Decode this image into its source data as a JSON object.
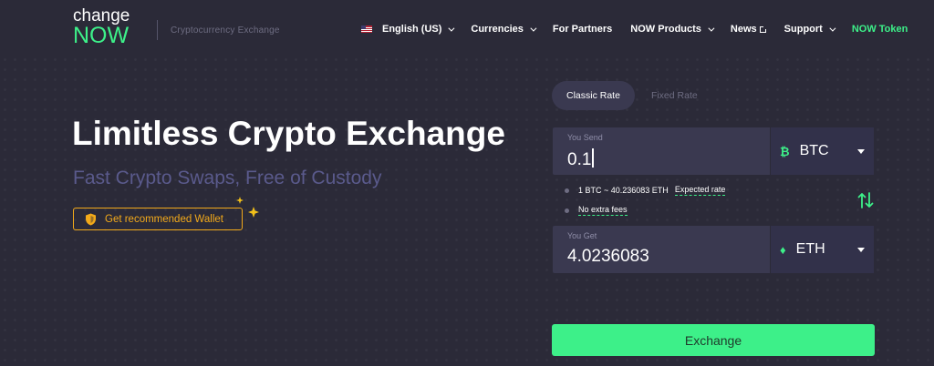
{
  "header": {
    "logo_top": "change",
    "logo_bottom": "NOW",
    "tagline": "Cryptocurrency Exchange",
    "nav": {
      "language": "English (US)",
      "currencies": "Currencies",
      "partners": "For Partners",
      "products": "NOW Products",
      "news": "News",
      "support": "Support",
      "token": "NOW Token"
    }
  },
  "hero": {
    "title": "Limitless Crypto Exchange",
    "subtitle": "Fast Crypto Swaps, Free of Custody",
    "wallet_button": "Get recommended Wallet"
  },
  "exchange": {
    "tabs": {
      "classic": "Classic Rate",
      "fixed": "Fixed Rate",
      "active": "classic"
    },
    "send": {
      "label": "You Send",
      "value": "0.1",
      "currency": "BTC",
      "symbol": "₿"
    },
    "rate": {
      "text": "1 BTC ~ 40.236083 ETH",
      "link": "Expected rate"
    },
    "fees": "No extra fees",
    "get": {
      "label": "You Get",
      "value": "4.0236083",
      "currency": "ETH",
      "symbol": "♦"
    },
    "button": "Exchange"
  },
  "colors": {
    "background": "#2b2a38",
    "accent_green": "#3df089",
    "wallet_orange": "#f2a91a",
    "field_bg": "#3a3950",
    "subtitle": "#5a5a8c"
  },
  "icons": [
    "us-flag-icon",
    "chevron-down-icon",
    "external-link-icon",
    "shield-icon",
    "star-icon",
    "bitcoin-icon",
    "ethereum-icon",
    "swap-arrows-icon",
    "dropdown-triangle-icon"
  ]
}
